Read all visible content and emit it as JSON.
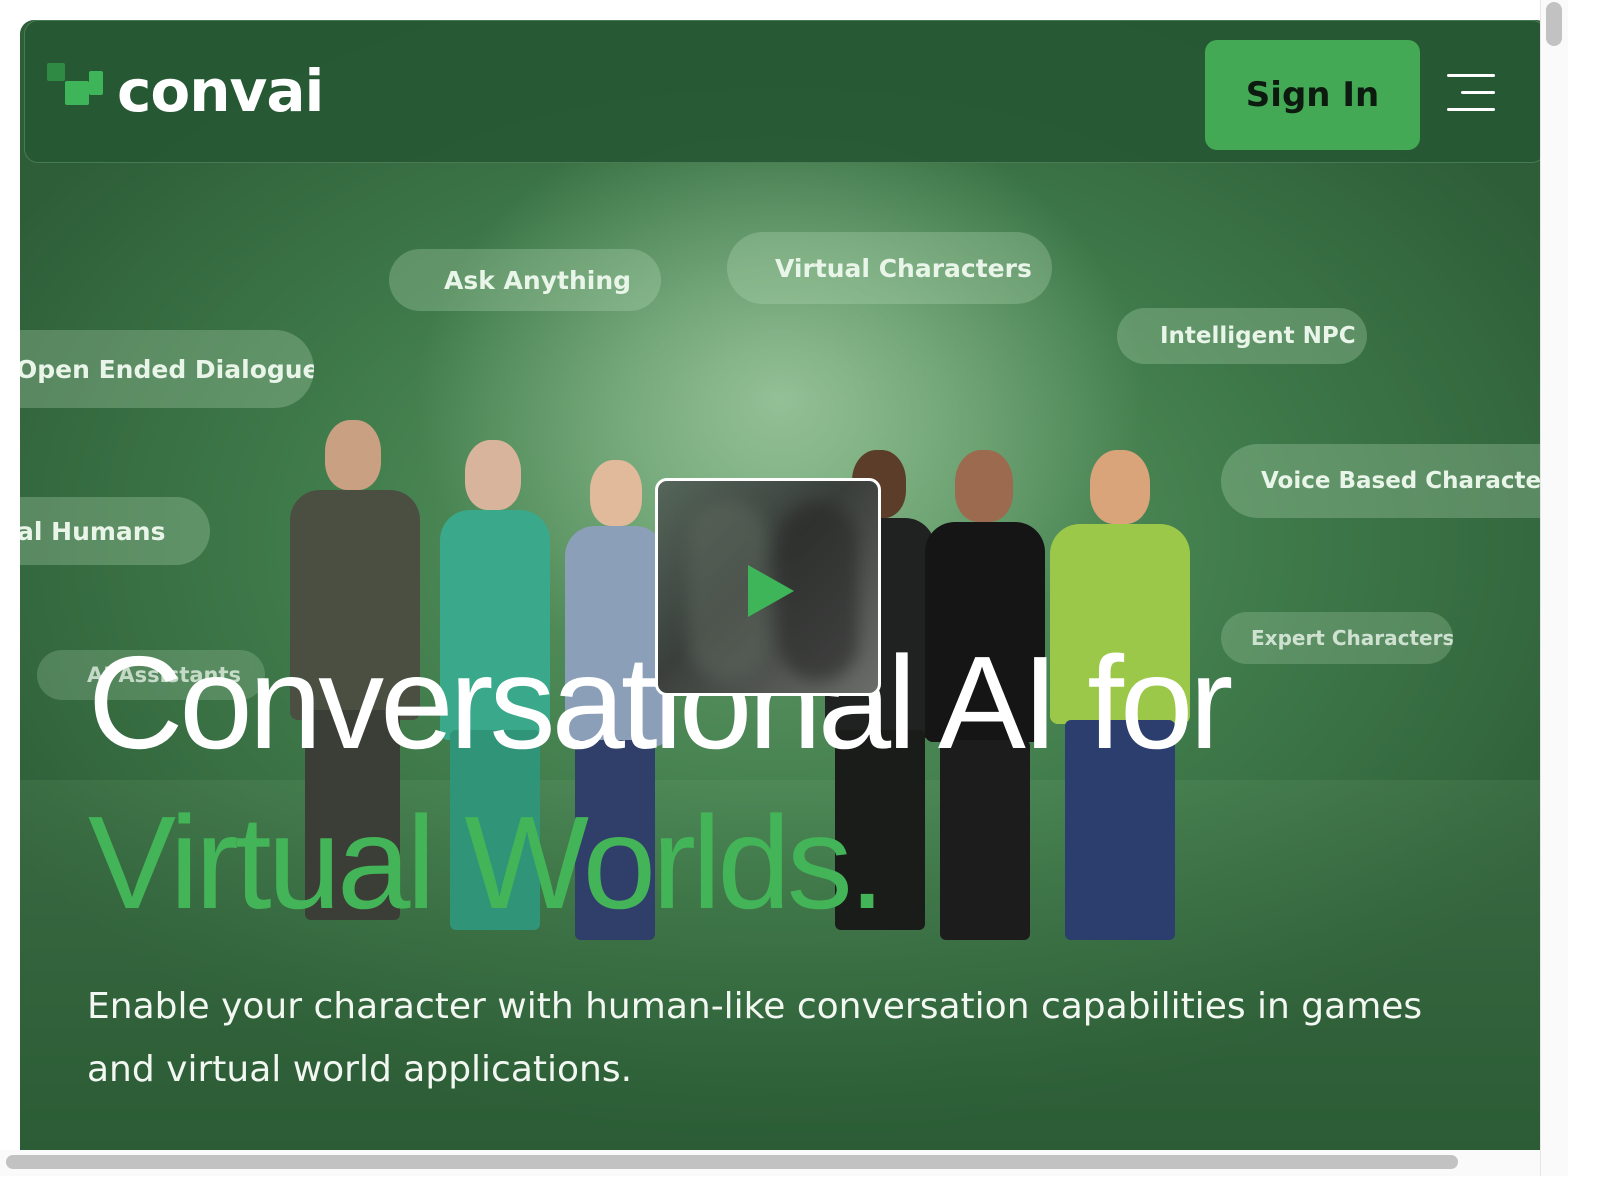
{
  "header": {
    "logo_text": "convai",
    "sign_in_label": "Sign In",
    "menu_icon": "hamburger-menu-icon"
  },
  "pills": [
    "Ask Anything",
    "Virtual Characters",
    "Intelligent NPC",
    "Open Ended Dialogue",
    "Voice Based Characters",
    "al Humans",
    "Expert Characters",
    "AI Assistants"
  ],
  "hero": {
    "headline_line1": "Conversational AI for",
    "headline_line2": "Virtual Worlds.",
    "subtitle": "Enable your character with human-like conversation capabilities in games and virtual world applications."
  },
  "video": {
    "play_icon": "play-icon"
  },
  "colors": {
    "accent_green": "#43b457",
    "button_green": "#43a954",
    "hero_bg": "#3f7a4a"
  }
}
